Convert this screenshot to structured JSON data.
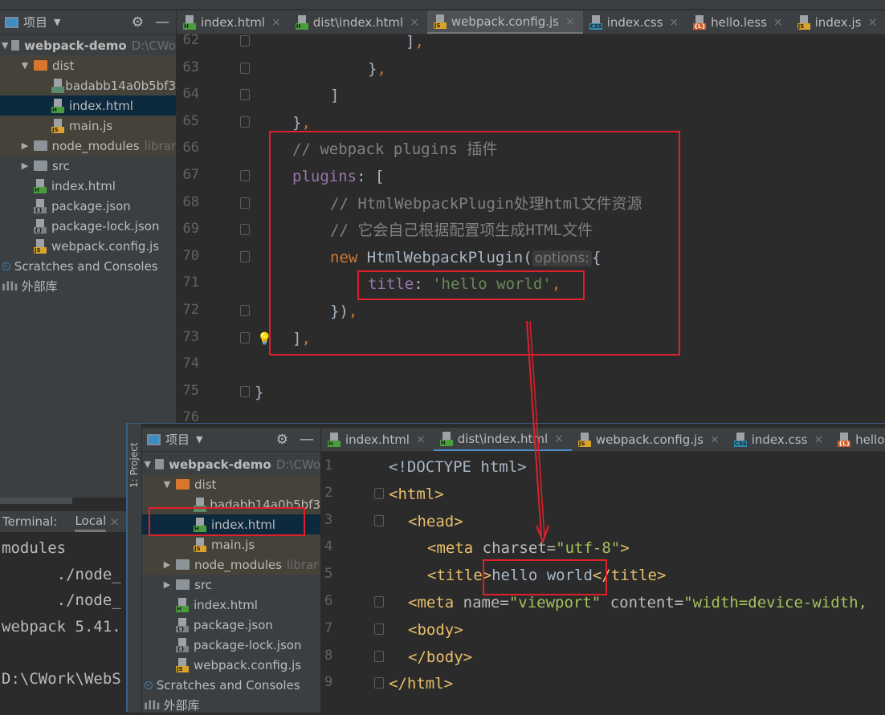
{
  "main": {
    "sidebar": {
      "title": "项目",
      "items": [
        {
          "label": "webpack-demo",
          "hint": "D:\\CWo",
          "type": "folder",
          "depth": 0,
          "open": true,
          "bold": true
        },
        {
          "label": "dist",
          "type": "folder-orange",
          "depth": 1,
          "open": true
        },
        {
          "label": "badabb14a0b5bf3",
          "type": "img",
          "depth": 2
        },
        {
          "label": "index.html",
          "type": "h",
          "depth": 2,
          "selected": true
        },
        {
          "label": "main.js",
          "type": "js",
          "depth": 2
        },
        {
          "label": "node_modules",
          "hint": "librar",
          "type": "folder",
          "depth": 1,
          "open": false
        },
        {
          "label": "src",
          "type": "folder",
          "depth": 1,
          "open": false
        },
        {
          "label": "index.html",
          "type": "h",
          "depth": 1
        },
        {
          "label": "package.json",
          "type": "json",
          "depth": 1
        },
        {
          "label": "package-lock.json",
          "type": "json",
          "depth": 1
        },
        {
          "label": "webpack.config.js",
          "type": "js",
          "depth": 1
        },
        {
          "label": "Scratches and Consoles",
          "type": "scratch",
          "depth": 0
        },
        {
          "label": "外部库",
          "type": "lib",
          "depth": 0
        }
      ]
    },
    "tabs": [
      {
        "label": "index.html",
        "icon": "h"
      },
      {
        "label": "dist\\index.html",
        "icon": "h"
      },
      {
        "label": "webpack.config.js",
        "icon": "js",
        "active": true
      },
      {
        "label": "index.css",
        "icon": "css"
      },
      {
        "label": "hello.less",
        "icon": "less"
      },
      {
        "label": "index.js",
        "icon": "js"
      }
    ],
    "code": [
      {
        "n": "62",
        "indent": 6,
        "t": [
          [
            "]",
            "pun"
          ],
          [
            ",",
            "com"
          ]
        ]
      },
      {
        "n": "63",
        "indent": 4,
        "t": [
          [
            "}",
            "pun"
          ],
          [
            ",",
            "com"
          ]
        ]
      },
      {
        "n": "64",
        "indent": 2,
        "t": [
          [
            "]",
            "pun"
          ]
        ]
      },
      {
        "n": "65",
        "indent": 0,
        "t": [
          [
            "}",
            "pun"
          ],
          [
            ",",
            "com"
          ]
        ]
      },
      {
        "n": "66",
        "indent": 0,
        "t": [
          [
            "// webpack plugins 插件",
            "cm"
          ]
        ]
      },
      {
        "n": "67",
        "indent": 0,
        "t": [
          [
            "plugins",
            "prop"
          ],
          [
            ": [",
            "pun"
          ]
        ]
      },
      {
        "n": "68",
        "indent": 2,
        "t": [
          [
            "// HtmlWebpackPlugin处理html文件资源",
            "cm"
          ]
        ]
      },
      {
        "n": "69",
        "indent": 2,
        "t": [
          [
            "// 它会自己根据配置项生成HTML文件",
            "cm"
          ]
        ]
      },
      {
        "n": "70",
        "indent": 2,
        "t": [
          [
            "new ",
            "kw"
          ],
          [
            "HtmlWebpackPlugin(",
            "pun"
          ],
          [
            "options:",
            "hint"
          ],
          [
            "{",
            "pun"
          ]
        ]
      },
      {
        "n": "71",
        "indent": 4,
        "t": [
          [
            "title",
            "prop"
          ],
          [
            ": ",
            "pun"
          ],
          [
            "'hello world'",
            "str"
          ],
          [
            ",",
            "com"
          ]
        ]
      },
      {
        "n": "72",
        "indent": 2,
        "t": [
          [
            "})",
            "pun"
          ],
          [
            ",",
            "com"
          ]
        ]
      },
      {
        "n": "73",
        "indent": 0,
        "t": [
          [
            "]",
            "pun"
          ],
          [
            ",",
            "com"
          ]
        ]
      },
      {
        "n": "74",
        "indent": 0,
        "t": []
      },
      {
        "n": "75",
        "indent": -2,
        "t": [
          [
            "}",
            "pun"
          ]
        ]
      },
      {
        "n": "76",
        "indent": 0,
        "t": []
      }
    ],
    "terminal": {
      "label": "Terminal:",
      "tab": "Local",
      "lines": [
        "modules",
        "      ./node_",
        "      ./node_",
        "webpack 5.41.",
        "",
        "D:\\CWork\\WebS"
      ]
    }
  },
  "overlay": {
    "strip_label": "1: Project",
    "sidebar_title": "项目",
    "tabs": [
      {
        "label": "index.html",
        "icon": "h"
      },
      {
        "label": "dist\\index.html",
        "icon": "h",
        "active": true
      },
      {
        "label": "webpack.config.js",
        "icon": "js"
      },
      {
        "label": "index.css",
        "icon": "css"
      },
      {
        "label": "hello.",
        "icon": "less"
      }
    ],
    "code": [
      {
        "n": "1",
        "indent": 0,
        "t": [
          [
            "<!DOCTYPE html>",
            "txt"
          ]
        ]
      },
      {
        "n": "2",
        "indent": 0,
        "t": [
          [
            "<html>",
            "tag"
          ]
        ]
      },
      {
        "n": "3",
        "indent": 1,
        "t": [
          [
            "<head>",
            "tag"
          ]
        ]
      },
      {
        "n": "4",
        "indent": 2,
        "t": [
          [
            "<meta ",
            "tag"
          ],
          [
            "charset=",
            "attr"
          ],
          [
            "\"utf-8\"",
            "aval"
          ],
          [
            ">",
            "tag"
          ]
        ]
      },
      {
        "n": "5",
        "indent": 2,
        "t": [
          [
            "<title>",
            "tag"
          ],
          [
            "hello world",
            "txt"
          ],
          [
            "</title>",
            "tag"
          ]
        ]
      },
      {
        "n": "6",
        "indent": 1,
        "t": [
          [
            "<meta ",
            "tag"
          ],
          [
            "name=",
            "attr"
          ],
          [
            "\"viewport\" ",
            "aval"
          ],
          [
            "content=",
            "attr"
          ],
          [
            "\"width=device-width,",
            "aval"
          ]
        ]
      },
      {
        "n": "7",
        "indent": 1,
        "t": [
          [
            "<body>",
            "tag"
          ]
        ]
      },
      {
        "n": "8",
        "indent": 1,
        "t": [
          [
            "</body>",
            "tag"
          ]
        ]
      },
      {
        "n": "9",
        "indent": 0,
        "t": [
          [
            "</html>",
            "tag"
          ]
        ]
      }
    ]
  },
  "colors": {
    "annotation": "#e0202a",
    "keyword": "#cc7832",
    "string": "#6a8759",
    "property": "#9876aa",
    "comment": "#808080",
    "tag": "#e8bf6a"
  }
}
